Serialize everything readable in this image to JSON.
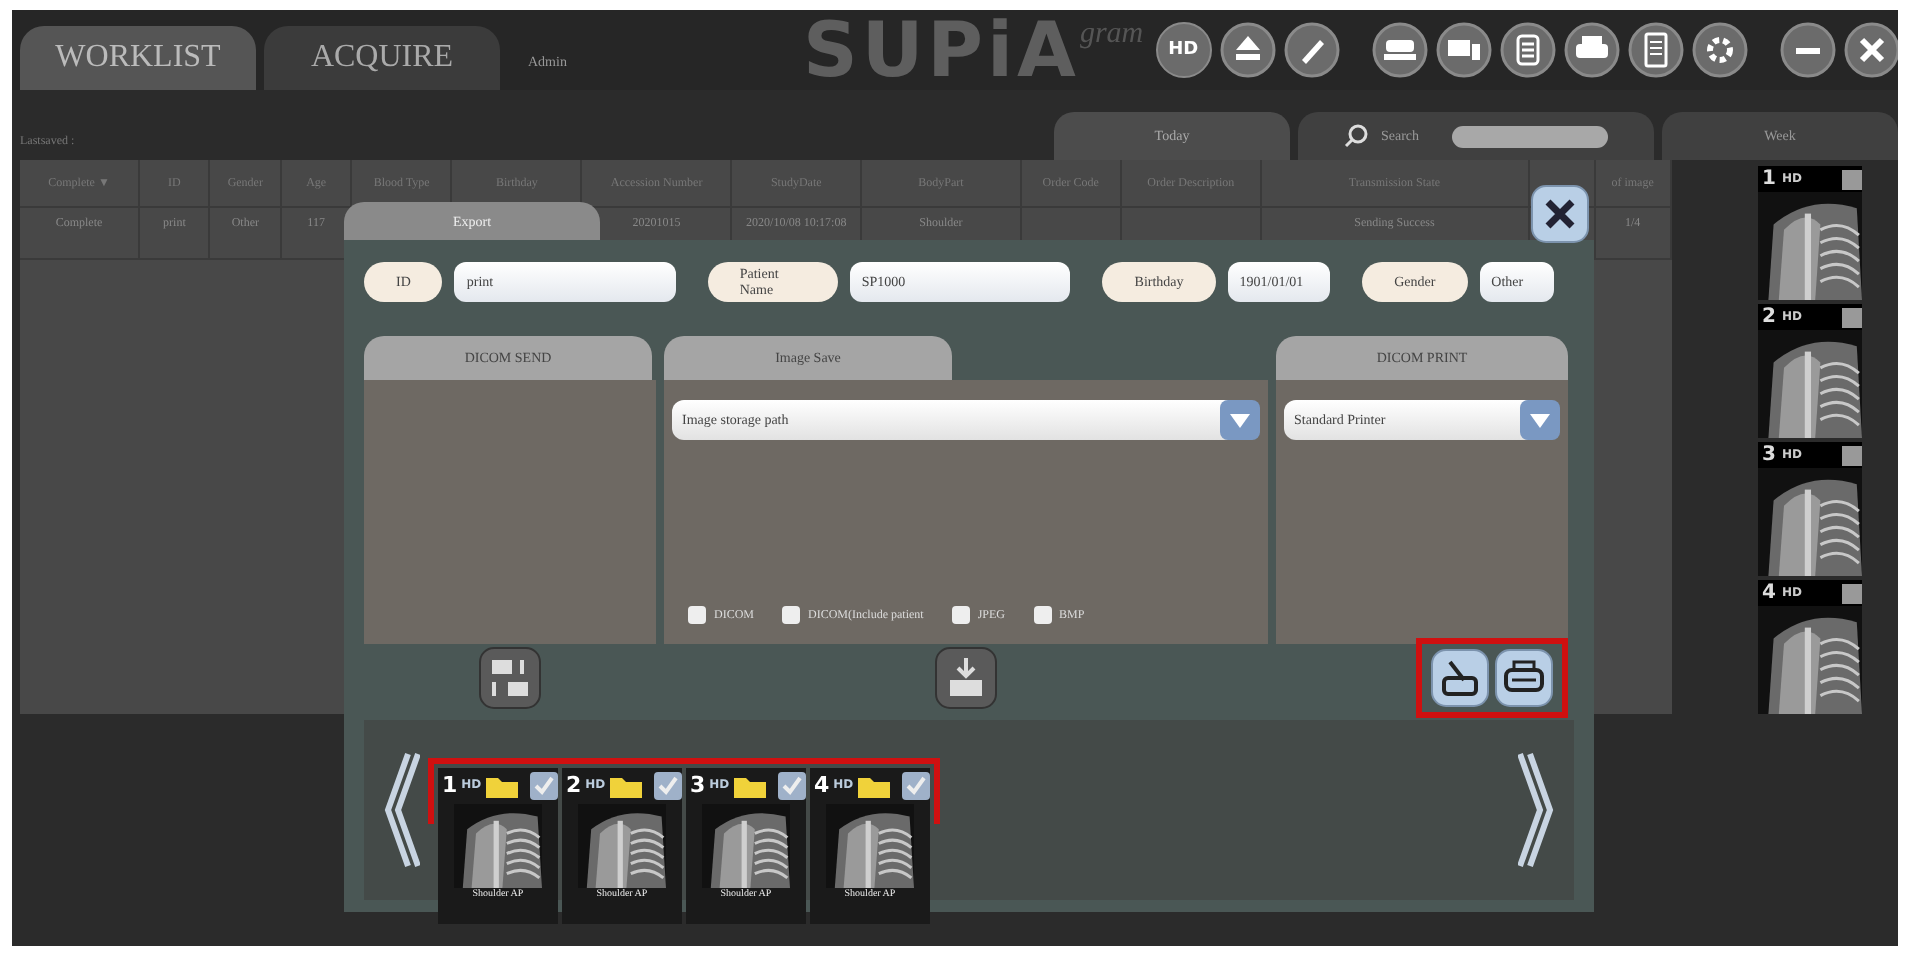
{
  "top_tabs": [
    {
      "label": "WORKLIST",
      "selected": true
    },
    {
      "label": "ACQUIRE",
      "selected": false
    }
  ],
  "user": "Admin",
  "logo": {
    "name": "SUPiA",
    "suffix": "gram"
  },
  "toolbar": [
    {
      "kind": "hd",
      "label": "HD"
    },
    {
      "kind": "eject"
    },
    {
      "kind": "pen"
    },
    {
      "kind": "scanner"
    },
    {
      "kind": "devices"
    },
    {
      "kind": "list"
    },
    {
      "kind": "printer"
    },
    {
      "kind": "doc"
    },
    {
      "kind": "gear"
    },
    {
      "kind": "minimize"
    },
    {
      "kind": "close"
    }
  ],
  "last_saved": "Lastsaved :",
  "filter_tabs": [
    {
      "kind": "text",
      "label": "Today",
      "selected": true
    },
    {
      "kind": "search",
      "label": "Search",
      "selected": false
    },
    {
      "kind": "text",
      "label": "Week",
      "selected": false
    }
  ],
  "table": {
    "columns": [
      "Complete ▼",
      "ID",
      "Gender",
      "Age",
      "Blood Type",
      "Birthday",
      "Accession Number",
      "StudyDate",
      "BodyPart",
      "Order Code",
      "Order Description",
      "Transmission State",
      "of image"
    ],
    "rows": [
      [
        "Complete",
        "print",
        "Other",
        "117",
        "",
        "",
        "20201015",
        "2020/10/08 10:17:08",
        "Shoulder",
        "",
        "",
        "Sending Success",
        "1/4"
      ]
    ]
  },
  "side_thumbs": [
    {
      "number": "1",
      "badge": "HD"
    },
    {
      "number": "2",
      "badge": "HD"
    },
    {
      "number": "3",
      "badge": "HD"
    },
    {
      "number": "4",
      "badge": "HD"
    }
  ],
  "dialog": {
    "title": "Export",
    "fields": [
      {
        "label": "ID",
        "value": "print"
      },
      {
        "label": "Patient Name",
        "value": "SP1000"
      },
      {
        "label": "Birthday",
        "value": "1901/01/01"
      },
      {
        "label": "Gender",
        "value": "Other"
      }
    ],
    "panels": [
      {
        "kind": "send",
        "title": "DICOM SEND"
      },
      {
        "kind": "save",
        "title": "Image Save",
        "dropdown": "Image storage path",
        "options": [
          {
            "label": "DICOM",
            "checked": false
          },
          {
            "label": "DICOM(Include patient",
            "checked": false
          },
          {
            "label": "JPEG",
            "checked": false
          },
          {
            "label": "BMP",
            "checked": false
          }
        ]
      },
      {
        "kind": "print",
        "title": "DICOM PRINT",
        "dropdown": "Standard Printer"
      }
    ],
    "thumbs": [
      {
        "number": "1",
        "badge": "HD",
        "caption": "Shoulder AP"
      },
      {
        "number": "2",
        "badge": "HD",
        "caption": "Shoulder AP"
      },
      {
        "number": "3",
        "badge": "HD",
        "caption": "Shoulder AP"
      },
      {
        "number": "4",
        "badge": "HD",
        "caption": "Shoulder AP"
      }
    ]
  }
}
